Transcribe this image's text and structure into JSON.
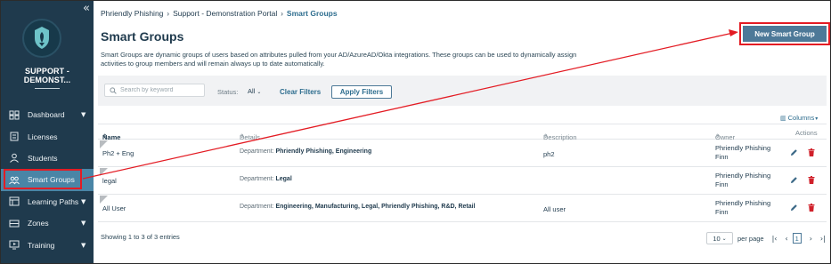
{
  "sidebar": {
    "org_name": "SUPPORT - DEMONST...",
    "collapse_icon": "«",
    "items": [
      {
        "label": "Dashboard",
        "icon": "dashboard-icon",
        "has_chevron": true
      },
      {
        "label": "Licenses",
        "icon": "licenses-icon",
        "has_chevron": false
      },
      {
        "label": "Students",
        "icon": "students-icon",
        "has_chevron": false
      },
      {
        "label": "Smart Groups",
        "icon": "smart-groups-icon",
        "has_chevron": false,
        "active": true
      },
      {
        "label": "Learning Paths",
        "icon": "learning-paths-icon",
        "has_chevron": true
      },
      {
        "label": "Zones",
        "icon": "zones-icon",
        "has_chevron": true
      },
      {
        "label": "Training",
        "icon": "training-icon",
        "has_chevron": true
      }
    ]
  },
  "breadcrumb": {
    "items": [
      "Phriendly Phishing",
      "Support - Demonstration Portal",
      "Smart Groups"
    ],
    "separator": "›"
  },
  "page": {
    "title": "Smart Groups",
    "description": "Smart Groups are dynamic groups of users based on attributes pulled from your AD/AzureAD/Okta integrations. These groups can be used to dynamically assign activities to group members and will remain always up to date automatically.",
    "new_button": "New Smart Group"
  },
  "filters": {
    "search_placeholder": "Search by keyword",
    "status_label": "Status:",
    "status_value": "All",
    "clear_label": "Clear Filters",
    "apply_label": "Apply Filters"
  },
  "table": {
    "columns_button": "Columns",
    "headers": {
      "name": "Name",
      "details": "Details",
      "description": "Description",
      "owner": "Owner",
      "actions": "Actions"
    },
    "rows": [
      {
        "name": "Ph2 + Eng",
        "detail_label": "Department:",
        "detail_value": "Phriendly Phishing, Engineering",
        "description": "ph2",
        "owner_line1": "Phriendly Phishing",
        "owner_line2": "Finn"
      },
      {
        "name": "legal",
        "detail_label": "Department:",
        "detail_value": "Legal",
        "description": "",
        "owner_line1": "Phriendly Phishing",
        "owner_line2": "Finn"
      },
      {
        "name": "All User",
        "detail_label": "Department:",
        "detail_value": "Engineering, Manufacturing, Legal, Phriendly Phishing, R&D, Retail",
        "description": "All user",
        "owner_line1": "Phriendly Phishing",
        "owner_line2": "Finn"
      }
    ]
  },
  "footer": {
    "info": "Showing 1 to 3 of 3 entries",
    "per_page_value": "10",
    "per_page_label": "per page",
    "current_page": "1"
  },
  "colors": {
    "sidebar_bg": "#1f3a4d",
    "active_item": "#4a85a6",
    "primary_button": "#4d7998",
    "annotation_red": "#e31b23",
    "delete_icon": "#d0202a"
  }
}
